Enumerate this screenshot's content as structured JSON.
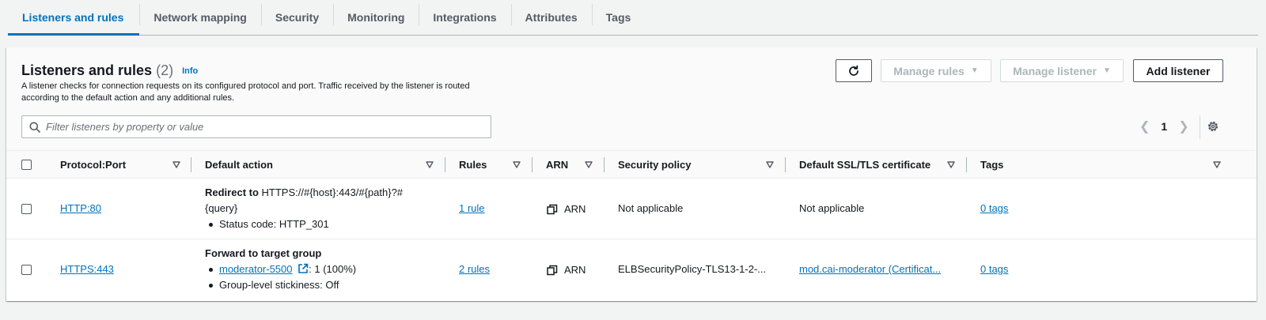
{
  "tabs": [
    {
      "label": "Listeners and rules",
      "active": true
    },
    {
      "label": "Network mapping"
    },
    {
      "label": "Security"
    },
    {
      "label": "Monitoring"
    },
    {
      "label": "Integrations"
    },
    {
      "label": "Attributes"
    },
    {
      "label": "Tags"
    }
  ],
  "panel": {
    "title": "Listeners and rules",
    "count": "(2)",
    "info": "Info",
    "description": "A listener checks for connection requests on its configured protocol and port. Traffic received by the listener is routed according to the default action and any additional rules."
  },
  "actions": {
    "manage_rules": "Manage rules",
    "manage_listener": "Manage listener",
    "add_listener": "Add listener"
  },
  "search": {
    "placeholder": "Filter listeners by property or value"
  },
  "pagination": {
    "current_page": "1"
  },
  "columns": {
    "protocol_port": "Protocol:Port",
    "default_action": "Default action",
    "rules": "Rules",
    "arn": "ARN",
    "security_policy": "Security policy",
    "certificate": "Default SSL/TLS certificate",
    "tags": "Tags"
  },
  "rows": [
    {
      "protocol_port": "HTTP:80",
      "action_title": "Redirect to",
      "action_target_line1": " HTTPS://#{host}:443/#{path}?#",
      "action_target_line2": "{query}",
      "action_bullet1": "Status code: HTTP_301",
      "rules": "1 rule",
      "arn": "ARN",
      "security_policy": "Not applicable",
      "certificate": "Not applicable",
      "tags": "0 tags"
    },
    {
      "protocol_port": "HTTPS:443",
      "action_title": "Forward to target group",
      "target_group": "moderator-5500",
      "target_weight": ": 1 (100%)",
      "action_bullet2": "Group-level stickiness: Off",
      "rules": "2 rules",
      "arn": "ARN",
      "security_policy": "ELBSecurityPolicy-TLS13-1-2-...",
      "certificate": "mod.cai-moderator (Certificat...",
      "tags": "0 tags"
    }
  ],
  "colors": {
    "link": "#0073bb",
    "text": "#16191f",
    "disabled": "#aab7b8",
    "background": "#f2f3f3"
  }
}
